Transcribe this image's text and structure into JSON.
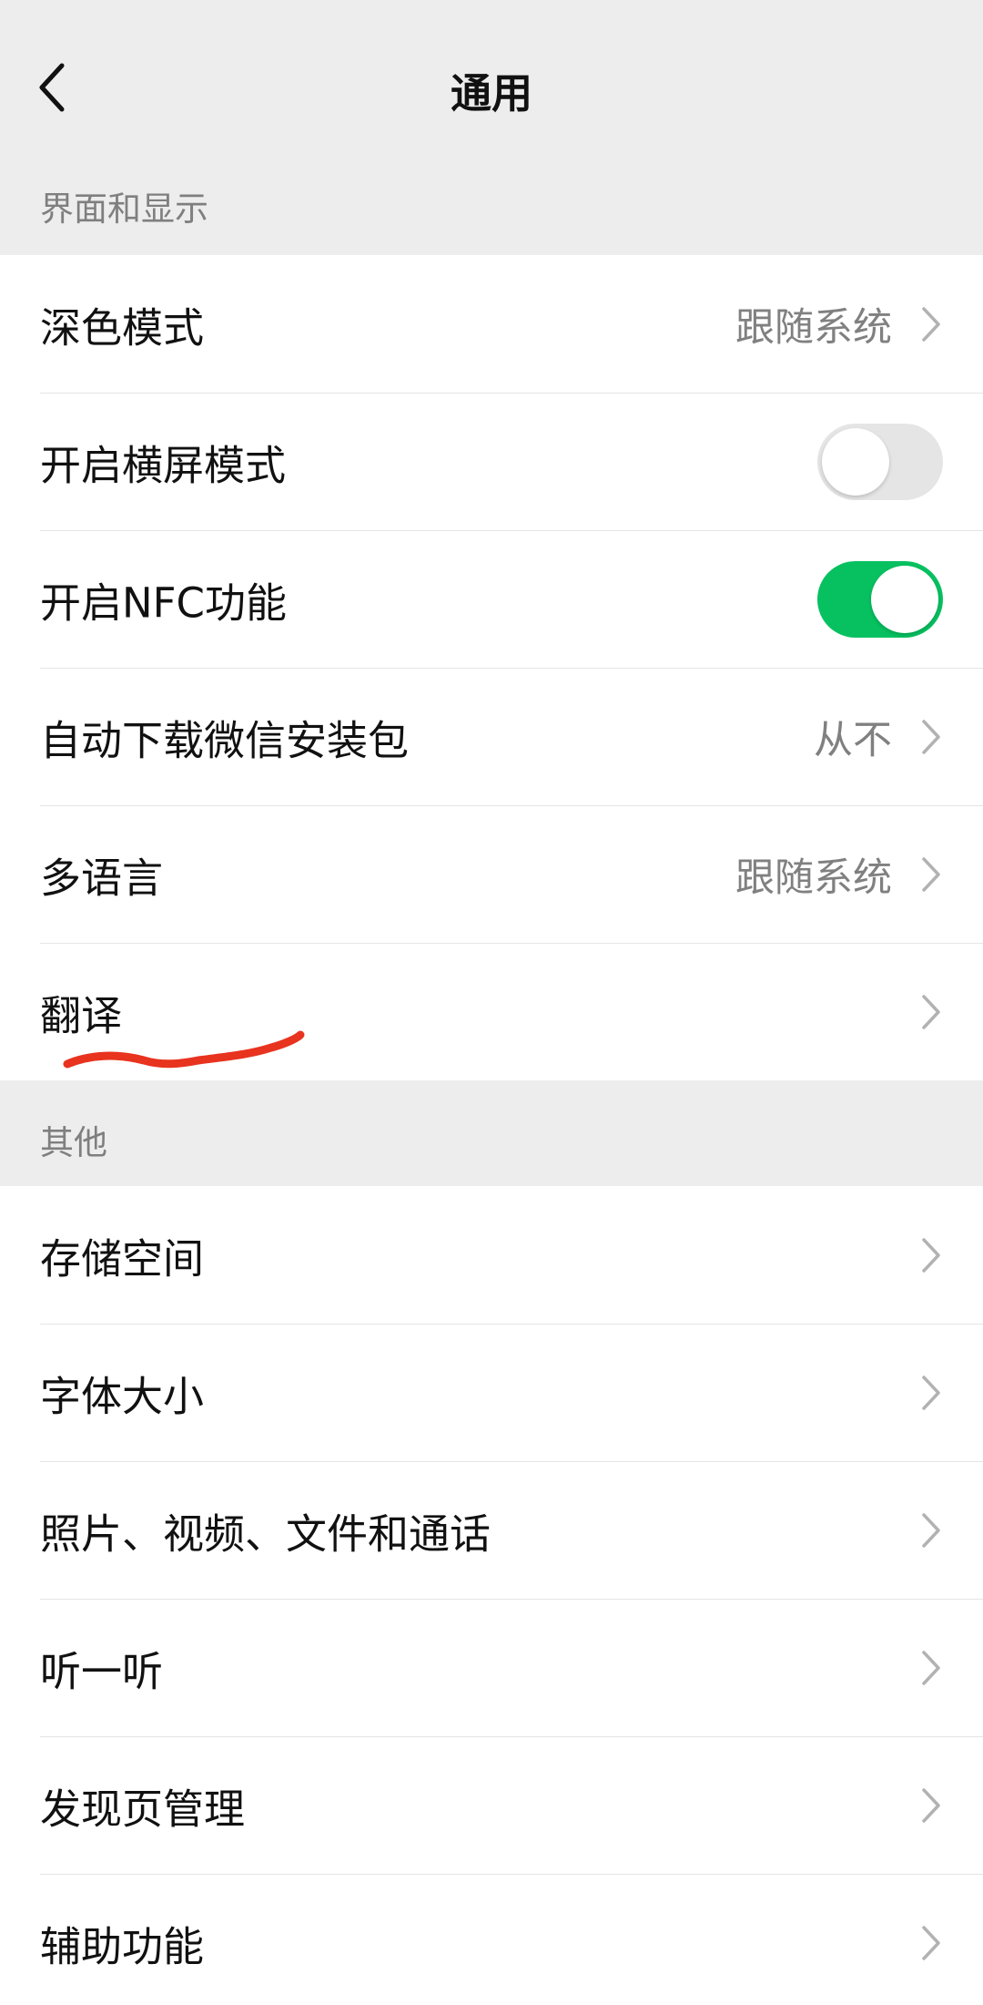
{
  "header": {
    "title": "通用",
    "back_icon": "chevron-left-icon"
  },
  "sections": {
    "display": {
      "title": "界面和显示",
      "items": [
        {
          "label": "深色模式",
          "value": "跟随系统"
        },
        {
          "label": "开启横屏模式",
          "toggle": false
        },
        {
          "label": "开启NFC功能",
          "toggle": true
        },
        {
          "label": "自动下载微信安装包",
          "value": "从不"
        },
        {
          "label": "多语言",
          "value": "跟随系统"
        },
        {
          "label": "翻译"
        }
      ]
    },
    "other": {
      "title": "其他",
      "items": [
        {
          "label": "存储空间"
        },
        {
          "label": "字体大小"
        },
        {
          "label": "照片、视频、文件和通话"
        },
        {
          "label": "听一听"
        },
        {
          "label": "发现页管理"
        },
        {
          "label": "辅助功能"
        }
      ]
    }
  },
  "colors": {
    "toggle_on": "#07c160",
    "toggle_off": "#e5e5e5",
    "annotation": "#e8331f"
  }
}
